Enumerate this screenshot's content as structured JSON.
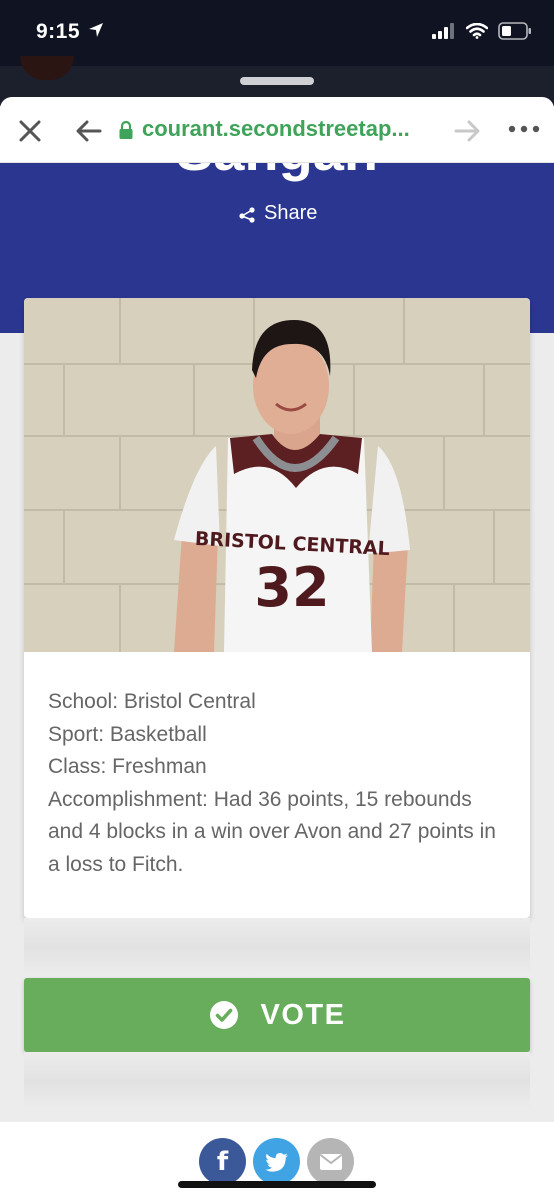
{
  "status": {
    "time": "9:15"
  },
  "browser": {
    "url": "courant.secondstreetap..."
  },
  "hero": {
    "name": "Sangan",
    "share_label": "Share"
  },
  "photo": {
    "jersey_text": "BRISTOL CENTRAL",
    "jersey_number": "32"
  },
  "details": {
    "school": "School: Bristol Central",
    "sport": "Sport: Basketball",
    "class": "Class: Freshman",
    "accomplishment": "Accomplishment: Had 36 points, 15 rebounds and 4 blocks in a win over Avon and 27 points in a loss to Fitch."
  },
  "vote": {
    "label": "VOTE"
  },
  "social": {
    "facebook_glyph": "f"
  },
  "colors": {
    "hero_blue": "#2b3691",
    "vote_green": "#67ad5b",
    "url_green": "#3fa35a"
  },
  "icons": [
    "location-arrow-icon",
    "signal-icon",
    "wifi-icon",
    "battery-icon",
    "close-icon",
    "back-arrow-icon",
    "lock-icon",
    "forward-arrow-icon",
    "more-icon",
    "share-icon",
    "check-circle-icon",
    "facebook-icon",
    "twitter-icon",
    "mail-icon"
  ]
}
